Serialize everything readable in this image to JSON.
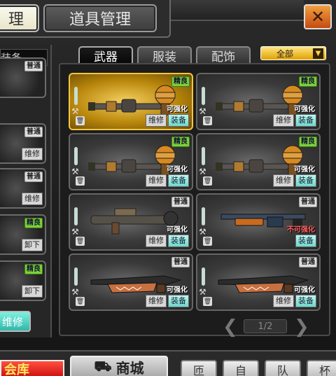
{
  "header": {
    "tab_left_label": "理",
    "tab_right_label": "道具管理",
    "close_icon": "✕"
  },
  "left_panel": {
    "header": "装备",
    "items": [
      {
        "badge": "普通",
        "badge_kind": "common",
        "action": ""
      },
      {
        "badge": "普通",
        "badge_kind": "common",
        "action": "维修"
      },
      {
        "badge": "普通",
        "badge_kind": "common",
        "action": "维修"
      },
      {
        "badge": "精良",
        "badge_kind": "fine",
        "action": "卸下"
      },
      {
        "badge": "精良",
        "badge_kind": "fine",
        "action": "卸下"
      }
    ],
    "repair_button": "维修"
  },
  "tabs": [
    "武器",
    "服装",
    "配饰"
  ],
  "filter": {
    "value": "全部"
  },
  "cards": [
    {
      "badge": "精良",
      "kind": "fine",
      "status": "可强化",
      "repair": "维修",
      "equip": "装备",
      "weapon": "rocket",
      "selected": true
    },
    {
      "badge": "精良",
      "kind": "fine",
      "status": "可强化",
      "repair": "维修",
      "equip": "装备",
      "weapon": "rocket",
      "selected": false
    },
    {
      "badge": "精良",
      "kind": "fine",
      "status": "可强化",
      "repair": "维修",
      "equip": "装备",
      "weapon": "rocket",
      "selected": false
    },
    {
      "badge": "精良",
      "kind": "fine",
      "status": "可强化",
      "repair": "维修",
      "equip": "装备",
      "weapon": "rocket",
      "selected": false
    },
    {
      "badge": "普通",
      "kind": "common",
      "status": "可强化",
      "repair": "维修",
      "equip": "装备",
      "weapon": "launcher",
      "selected": false
    },
    {
      "badge": "普通",
      "kind": "common",
      "status": "不可强化",
      "repair": "",
      "equip": "装备",
      "weapon": "shotgun",
      "selected": false
    },
    {
      "badge": "普通",
      "kind": "common",
      "status": "可强化",
      "repair": "维修",
      "equip": "装备",
      "weapon": "shark",
      "selected": false
    },
    {
      "badge": "普通",
      "kind": "common",
      "status": "可强化",
      "repair": "维修",
      "equip": "装备",
      "weapon": "shark",
      "selected": false
    }
  ],
  "pager": {
    "label": "1/2",
    "prev": "❮",
    "next": "❯"
  },
  "bottom": {
    "shop_red": "会库",
    "shop": "商城",
    "icons": [
      "匝",
      "自",
      "队",
      "杯"
    ]
  },
  "colors": {
    "fine": "#7bd03a",
    "common": "#dddddd",
    "accent": "#f2c640",
    "teal": "#6fd8cc"
  }
}
